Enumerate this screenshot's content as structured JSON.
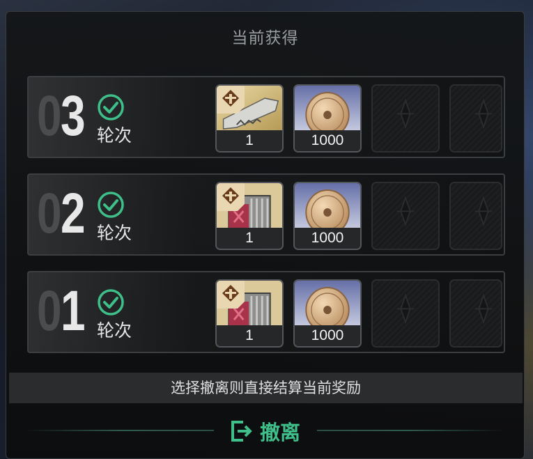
{
  "panel": {
    "title": "当前获得"
  },
  "rounds": [
    {
      "number_dim": "0",
      "number_bright": "3",
      "label": "轮次",
      "items": [
        {
          "qty": "1",
          "art": "blade"
        },
        {
          "qty": "1000",
          "art": "coin"
        }
      ]
    },
    {
      "number_dim": "0",
      "number_bright": "2",
      "label": "轮次",
      "items": [
        {
          "qty": "1",
          "art": "crate"
        },
        {
          "qty": "1000",
          "art": "coin"
        }
      ]
    },
    {
      "number_dim": "0",
      "number_bright": "1",
      "label": "轮次",
      "items": [
        {
          "qty": "1",
          "art": "crate"
        },
        {
          "qty": "1000",
          "art": "coin"
        }
      ]
    }
  ],
  "notice": "选择撤离则直接结算当前奖励",
  "evacuate": {
    "label": "撤离",
    "icon": "exit-icon"
  },
  "colors": {
    "accent_green": "#3fbf8a",
    "badge_bg": "#e9d7b2",
    "badge_brown": "#6a3a1c"
  }
}
